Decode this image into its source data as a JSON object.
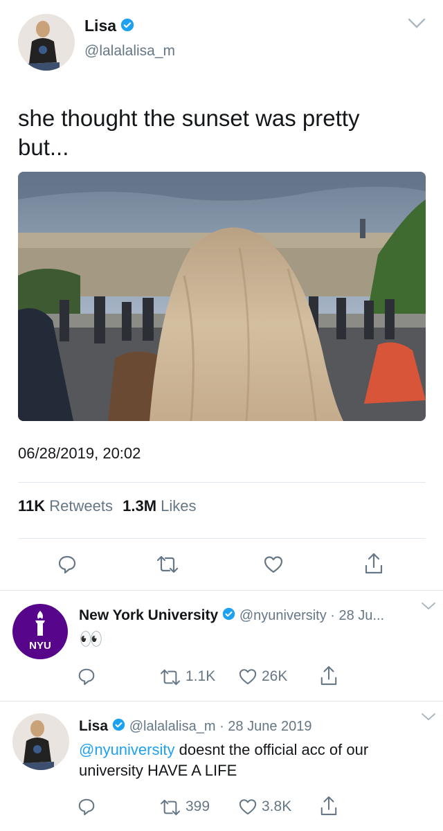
{
  "main_tweet": {
    "name": "Lisa",
    "handle": "@lalalalisa_m",
    "text_line1": "she thought the sunset was pretty",
    "text_line2": "but...",
    "timestamp": "06/28/2019, 20:02",
    "retweets_count": "11K",
    "retweets_label": "Retweets",
    "likes_count": "1.3M",
    "likes_label": "Likes"
  },
  "reply1": {
    "name": "New York University",
    "meta": "@nyuniversity · 28 Ju...",
    "avatar_text": "NYU",
    "text": "👀",
    "retweets": "1.1K",
    "likes": "26K"
  },
  "reply2": {
    "name": "Lisa",
    "meta": "@lalalalisa_m · 28 June 2019",
    "mention": "@nyuniversity",
    "text_rest": " doesnt the official acc of our",
    "text_line2": "university HAVE A LIFE",
    "retweets": "399",
    "likes": "3.8K"
  },
  "colors": {
    "accent": "#1da1f2",
    "nyu_purple": "#57068c",
    "grey": "#657786"
  }
}
